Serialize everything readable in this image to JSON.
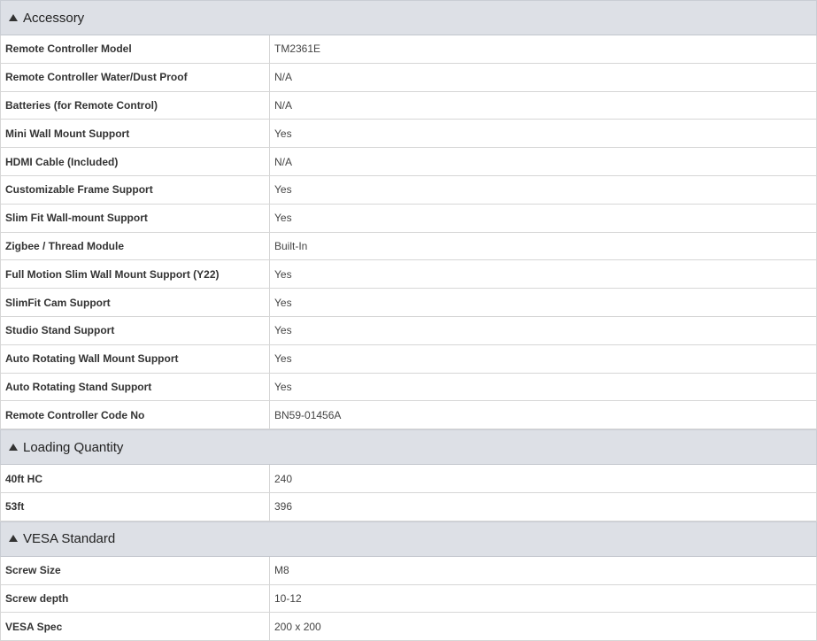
{
  "colors": {
    "header_bg": "#dde0e6",
    "border": "#d6d6d6",
    "text": "#333333"
  },
  "sections": [
    {
      "icon": "caret-up-icon",
      "title": "Accessory",
      "rows": [
        {
          "label": "Remote Controller Model",
          "value": "TM2361E"
        },
        {
          "label": "Remote Controller Water/Dust Proof",
          "value": "N/A"
        },
        {
          "label": "Batteries (for Remote Control)",
          "value": "N/A"
        },
        {
          "label": "Mini Wall Mount Support",
          "value": "Yes"
        },
        {
          "label": "HDMI Cable (Included)",
          "value": "N/A"
        },
        {
          "label": "Customizable Frame Support",
          "value": "Yes"
        },
        {
          "label": "Slim Fit Wall-mount Support",
          "value": "Yes"
        },
        {
          "label": "Zigbee / Thread Module",
          "value": "Built-In"
        },
        {
          "label": "Full Motion Slim Wall Mount Support (Y22)",
          "value": "Yes"
        },
        {
          "label": "SlimFit Cam Support",
          "value": "Yes"
        },
        {
          "label": "Studio Stand Support",
          "value": "Yes"
        },
        {
          "label": "Auto Rotating Wall Mount Support",
          "value": "Yes"
        },
        {
          "label": "Auto Rotating Stand Support",
          "value": "Yes"
        },
        {
          "label": "Remote Controller Code No",
          "value": "BN59-01456A"
        }
      ]
    },
    {
      "icon": "caret-up-icon",
      "title": "Loading Quantity",
      "rows": [
        {
          "label": "40ft HC",
          "value": "240"
        },
        {
          "label": "53ft",
          "value": "396"
        }
      ]
    },
    {
      "icon": "caret-up-icon",
      "title": "VESA Standard",
      "rows": [
        {
          "label": "Screw Size",
          "value": "M8"
        },
        {
          "label": "Screw depth",
          "value": "10-12"
        },
        {
          "label": "VESA Spec",
          "value": "200 x 200"
        }
      ]
    }
  ]
}
